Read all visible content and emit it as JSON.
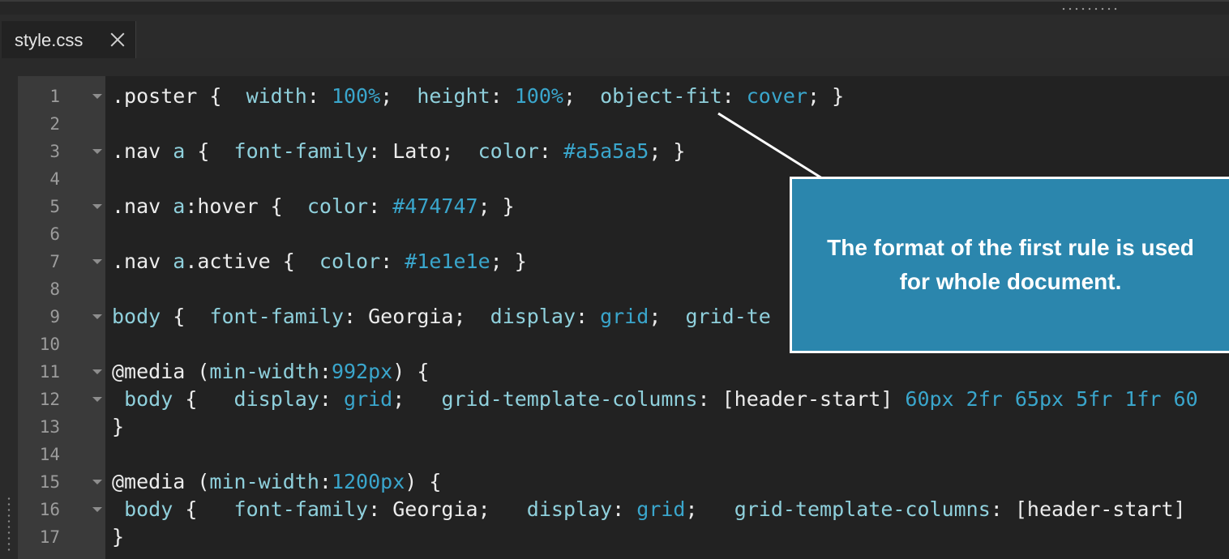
{
  "tab": {
    "filename": "style.css",
    "close_icon": "close-icon"
  },
  "colors": {
    "property": "#8fd0dc",
    "value": "#3aa6cc",
    "text": "#ececec",
    "gutter": "#3a3a3a",
    "callout": "#2b86ad"
  },
  "lines": [
    {
      "n": "1",
      "fold": true,
      "tokens": [
        {
          "t": ".poster {  ",
          "c": "txt"
        },
        {
          "t": "width",
          "c": "prop"
        },
        {
          "t": ": ",
          "c": "txt"
        },
        {
          "t": "100%",
          "c": "val"
        },
        {
          "t": ";  ",
          "c": "txt"
        },
        {
          "t": "height",
          "c": "prop"
        },
        {
          "t": ": ",
          "c": "txt"
        },
        {
          "t": "100%",
          "c": "val"
        },
        {
          "t": ";  ",
          "c": "txt"
        },
        {
          "t": "object-fit",
          "c": "prop"
        },
        {
          "t": ": ",
          "c": "txt"
        },
        {
          "t": "cover",
          "c": "val"
        },
        {
          "t": "; }",
          "c": "txt"
        }
      ]
    },
    {
      "n": "2",
      "fold": false,
      "tokens": []
    },
    {
      "n": "3",
      "fold": true,
      "tokens": [
        {
          "t": ".nav ",
          "c": "txt"
        },
        {
          "t": "a",
          "c": "prop"
        },
        {
          "t": " {  ",
          "c": "txt"
        },
        {
          "t": "font-family",
          "c": "prop"
        },
        {
          "t": ": Lato;  ",
          "c": "txt"
        },
        {
          "t": "color",
          "c": "prop"
        },
        {
          "t": ": ",
          "c": "txt"
        },
        {
          "t": "#a5a5a5",
          "c": "val"
        },
        {
          "t": "; }",
          "c": "txt"
        }
      ]
    },
    {
      "n": "4",
      "fold": false,
      "tokens": []
    },
    {
      "n": "5",
      "fold": true,
      "tokens": [
        {
          "t": ".nav ",
          "c": "txt"
        },
        {
          "t": "a",
          "c": "prop"
        },
        {
          "t": ":hover {  ",
          "c": "txt"
        },
        {
          "t": "color",
          "c": "prop"
        },
        {
          "t": ": ",
          "c": "txt"
        },
        {
          "t": "#474747",
          "c": "val"
        },
        {
          "t": "; }",
          "c": "txt"
        }
      ]
    },
    {
      "n": "6",
      "fold": false,
      "tokens": []
    },
    {
      "n": "7",
      "fold": true,
      "tokens": [
        {
          "t": ".nav ",
          "c": "txt"
        },
        {
          "t": "a",
          "c": "prop"
        },
        {
          "t": ".active {  ",
          "c": "txt"
        },
        {
          "t": "color",
          "c": "prop"
        },
        {
          "t": ": ",
          "c": "txt"
        },
        {
          "t": "#1e1e1e",
          "c": "val"
        },
        {
          "t": "; }",
          "c": "txt"
        }
      ]
    },
    {
      "n": "8",
      "fold": false,
      "tokens": []
    },
    {
      "n": "9",
      "fold": true,
      "tokens": [
        {
          "t": "body",
          "c": "prop"
        },
        {
          "t": " {  ",
          "c": "txt"
        },
        {
          "t": "font-family",
          "c": "prop"
        },
        {
          "t": ": Georgia;  ",
          "c": "txt"
        },
        {
          "t": "display",
          "c": "prop"
        },
        {
          "t": ": ",
          "c": "txt"
        },
        {
          "t": "grid",
          "c": "val"
        },
        {
          "t": ";  ",
          "c": "txt"
        },
        {
          "t": "grid-te",
          "c": "prop"
        }
      ]
    },
    {
      "n": "10",
      "fold": false,
      "tokens": []
    },
    {
      "n": "11",
      "fold": true,
      "tokens": [
        {
          "t": "@media (",
          "c": "txt"
        },
        {
          "t": "min-width",
          "c": "prop"
        },
        {
          "t": ":",
          "c": "txt"
        },
        {
          "t": "992px",
          "c": "val"
        },
        {
          "t": ") {",
          "c": "txt"
        }
      ]
    },
    {
      "n": "12",
      "fold": true,
      "tokens": [
        {
          "t": " ",
          "c": "txt"
        },
        {
          "t": "body",
          "c": "prop"
        },
        {
          "t": " {   ",
          "c": "txt"
        },
        {
          "t": "display",
          "c": "prop"
        },
        {
          "t": ": ",
          "c": "txt"
        },
        {
          "t": "grid",
          "c": "val"
        },
        {
          "t": ";   ",
          "c": "txt"
        },
        {
          "t": "grid-template-columns",
          "c": "prop"
        },
        {
          "t": ": [header-start] ",
          "c": "txt"
        },
        {
          "t": "60px 2fr 65px 5fr 1fr 60",
          "c": "val"
        }
      ]
    },
    {
      "n": "13",
      "fold": false,
      "tokens": [
        {
          "t": "}",
          "c": "txt"
        }
      ]
    },
    {
      "n": "14",
      "fold": false,
      "tokens": []
    },
    {
      "n": "15",
      "fold": true,
      "tokens": [
        {
          "t": "@media (",
          "c": "txt"
        },
        {
          "t": "min-width",
          "c": "prop"
        },
        {
          "t": ":",
          "c": "txt"
        },
        {
          "t": "1200px",
          "c": "val"
        },
        {
          "t": ") {",
          "c": "txt"
        }
      ]
    },
    {
      "n": "16",
      "fold": true,
      "tokens": [
        {
          "t": " ",
          "c": "txt"
        },
        {
          "t": "body",
          "c": "prop"
        },
        {
          "t": " {   ",
          "c": "txt"
        },
        {
          "t": "font-family",
          "c": "prop"
        },
        {
          "t": ": Georgia;   ",
          "c": "txt"
        },
        {
          "t": "display",
          "c": "prop"
        },
        {
          "t": ": ",
          "c": "txt"
        },
        {
          "t": "grid",
          "c": "val"
        },
        {
          "t": ";   ",
          "c": "txt"
        },
        {
          "t": "grid-template-columns",
          "c": "prop"
        },
        {
          "t": ": [header-start] ",
          "c": "txt"
        }
      ]
    },
    {
      "n": "17",
      "fold": false,
      "tokens": [
        {
          "t": "}",
          "c": "txt"
        }
      ]
    }
  ],
  "callout": {
    "text": "The format of the first rule is used for whole document."
  }
}
